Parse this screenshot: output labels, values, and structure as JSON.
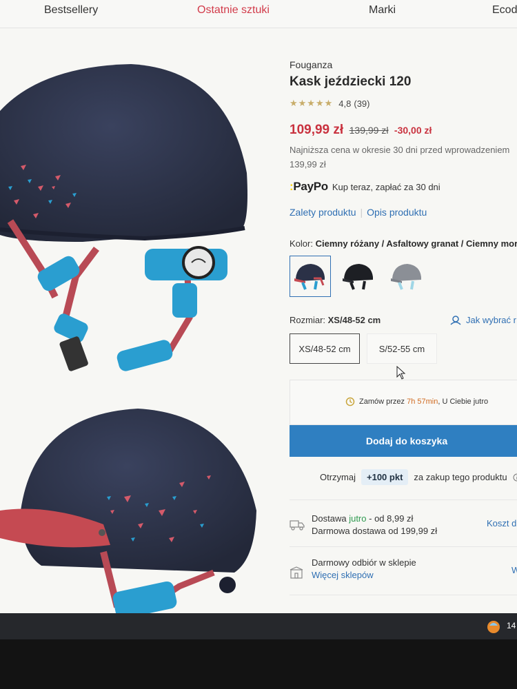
{
  "nav": {
    "items": [
      "Bestsellery",
      "Ostatnie sztuki",
      "Marki",
      "Ecod"
    ]
  },
  "product": {
    "brand": "Fouganza",
    "title": "Kask jeździecki 120",
    "stars": "★★★★★",
    "rating": "4,8",
    "reviews": "(39)",
    "price_now": "109,99 zł",
    "price_old": "139,99 zł",
    "price_discount": "-30,00 zł",
    "lowest_line1": "Najniższa cena w okresie 30 dni przed wprowadzeniem",
    "lowest_line2": "139,99 zł"
  },
  "paypo": {
    "logo": "PayPo",
    "text": "Kup teraz, zapłać za 30 dni"
  },
  "links": {
    "advantages": "Zalety produktu",
    "description": "Opis produktu"
  },
  "color": {
    "label": "Kolor:",
    "value": "Ciemny różany / Asfaltowy granat / Ciemny mors",
    "swatches": [
      "navy-rose",
      "black",
      "grey-blue"
    ]
  },
  "size": {
    "label": "Rozmiar:",
    "value": "XS/48-52 cm",
    "help": "Jak wybrać r",
    "options": [
      "XS/48-52 cm",
      "S/52-55 cm"
    ]
  },
  "delivery_box": {
    "prefix": "Zamów przez",
    "time": "7h 57min",
    "suffix": ", U Ciebie jutro"
  },
  "add_to_cart": "Dodaj do koszyka",
  "points": {
    "prefix": "Otrzymaj",
    "value": "+100 pkt",
    "suffix": "za zakup tego produktu"
  },
  "shipping": {
    "line1_prefix": "Dostawa",
    "line1_highlight": "jutro",
    "line1_suffix": "- od 8,99 zł",
    "line2": "Darmowa dostawa od 199,99 zł",
    "side": "Koszt d"
  },
  "pickup": {
    "line1": "Darmowy odbiór w sklepie",
    "line2": "Więcej sklepów",
    "side": "W"
  },
  "taskbar": {
    "clock": "14"
  },
  "colors": {
    "accent": "#2f7fc1",
    "price": "#c9323f",
    "link": "#2f6fb3",
    "helmet_navy": "#2b3147",
    "helmet_rose": "#c54a52",
    "helmet_teal": "#2a9ed0"
  }
}
